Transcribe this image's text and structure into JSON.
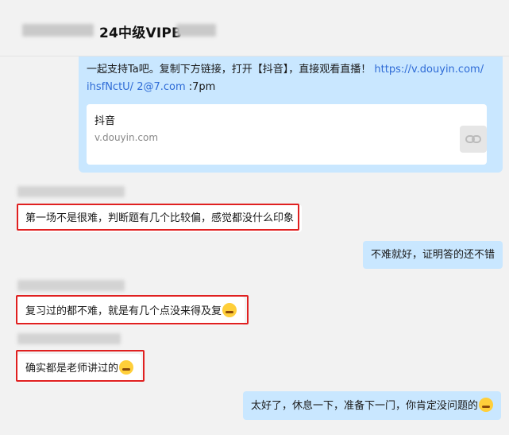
{
  "header": {
    "title": "24中级VIPB"
  },
  "share": {
    "text_before": "一起支持Ta吧。复制下方链接，打开【抖音】，直接观看直播！ ",
    "link_part1": "https://v.douyin.com/",
    "link_part2": "ihsfNctU/ 2@7.com",
    "text_after": " :7pm",
    "card_title": "抖音",
    "card_domain": "v.douyin.com"
  },
  "messages": [
    {
      "side": "left",
      "text": "第一场不是很难，判断题有几个比较偏，感觉都没什么印象"
    },
    {
      "side": "right",
      "text": "不难就好，证明答的还不错"
    },
    {
      "side": "left",
      "text": "复习过的都不难，就是有几个点没来得及复"
    },
    {
      "side": "left",
      "text": "确实都是老师讲过的"
    },
    {
      "side": "right",
      "text": "太好了，休息一下，准备下一门，你肯定没问题的"
    }
  ],
  "colors": {
    "bubble_right": "#c9e7ff",
    "bubble_left": "#ffffff",
    "highlight_box": "#e02020",
    "link": "#2e6bd6"
  }
}
